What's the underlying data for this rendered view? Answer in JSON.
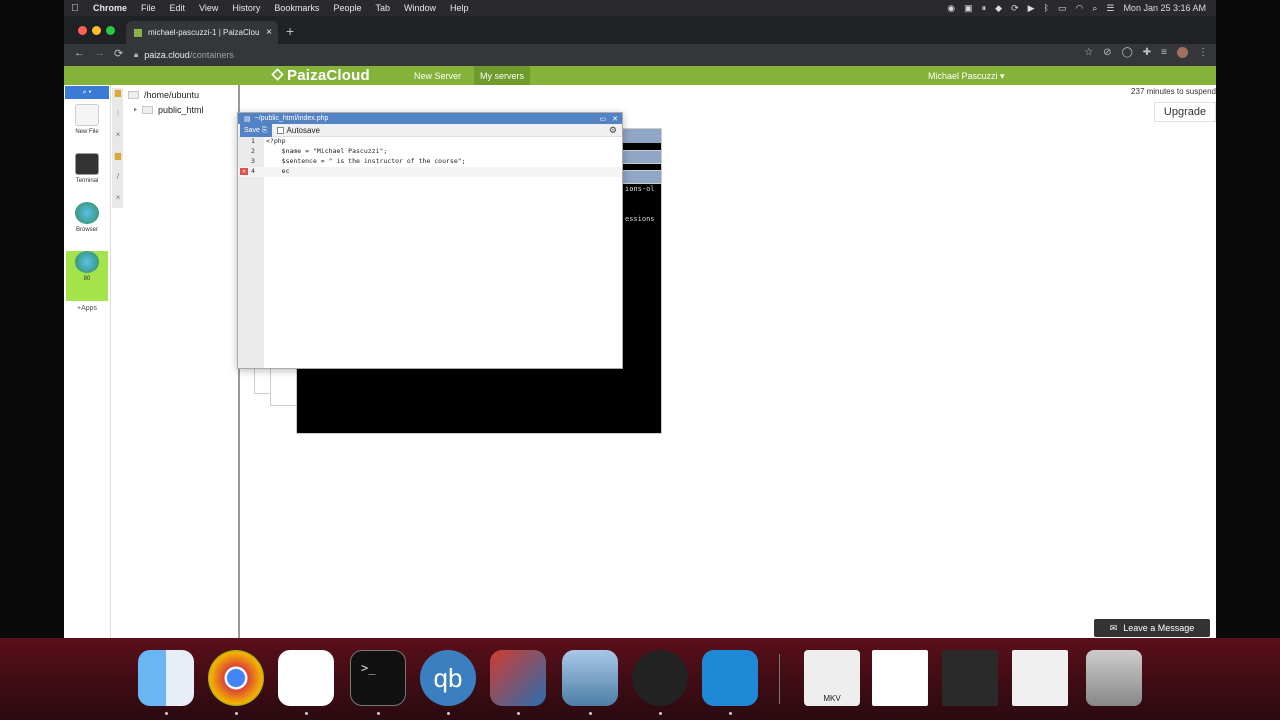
{
  "menubar": {
    "app": "Chrome",
    "items": [
      "File",
      "Edit",
      "View",
      "History",
      "Bookmarks",
      "People",
      "Tab",
      "Window",
      "Help"
    ],
    "clock": "Mon Jan 25  3:16 AM"
  },
  "browser": {
    "tab_title": "michael-pascuzzi-1 | PaizaClou",
    "url_host": "paiza.cloud",
    "url_path": "/containers"
  },
  "paiza": {
    "logo": "PaizaCloud",
    "nav_new_server": "New Server",
    "nav_my_servers": "My servers",
    "user": "Michael Pascuzzi",
    "suspend_text": "237 minutes to suspend",
    "upgrade_label": "Upgrade",
    "apps": [
      {
        "label": "New File",
        "icon": "new-file-icon"
      },
      {
        "label": "Terminal",
        "icon": "terminal-icon"
      },
      {
        "label": "Browser",
        "icon": "globe-icon"
      },
      {
        "label": "80",
        "icon": "globe-icon"
      }
    ],
    "apps_button": "Apps",
    "filetree": {
      "root": "/home/ubuntu",
      "children": [
        "public_html"
      ]
    },
    "editor": {
      "title": "~/public_html/index.php",
      "save_label": "Save",
      "autosave_label": "Autosave",
      "lines": [
        {
          "n": "1",
          "text": "<?php"
        },
        {
          "n": "2",
          "text": "    $name = \"Michael Pascuzzi\";"
        },
        {
          "n": "3",
          "text": "    $sentence = \" is the instructor of the course\";"
        },
        {
          "n": "4",
          "text": "    ec"
        }
      ],
      "error_line": "4"
    },
    "terminal_fragments": [
      "ions-ol",
      "essions"
    ],
    "leave_message": "Leave a Message"
  },
  "dock": {
    "items": [
      "Finder",
      "Chrome",
      "Slack",
      "Terminal",
      "qBittorrent",
      "Remote Desktop",
      "Preview",
      "OBS",
      "Visual Studio Code",
      "VLC",
      "Screenshot",
      "Screenshot",
      "Screenshot",
      "Trash"
    ],
    "mkv_label": "MKV"
  }
}
